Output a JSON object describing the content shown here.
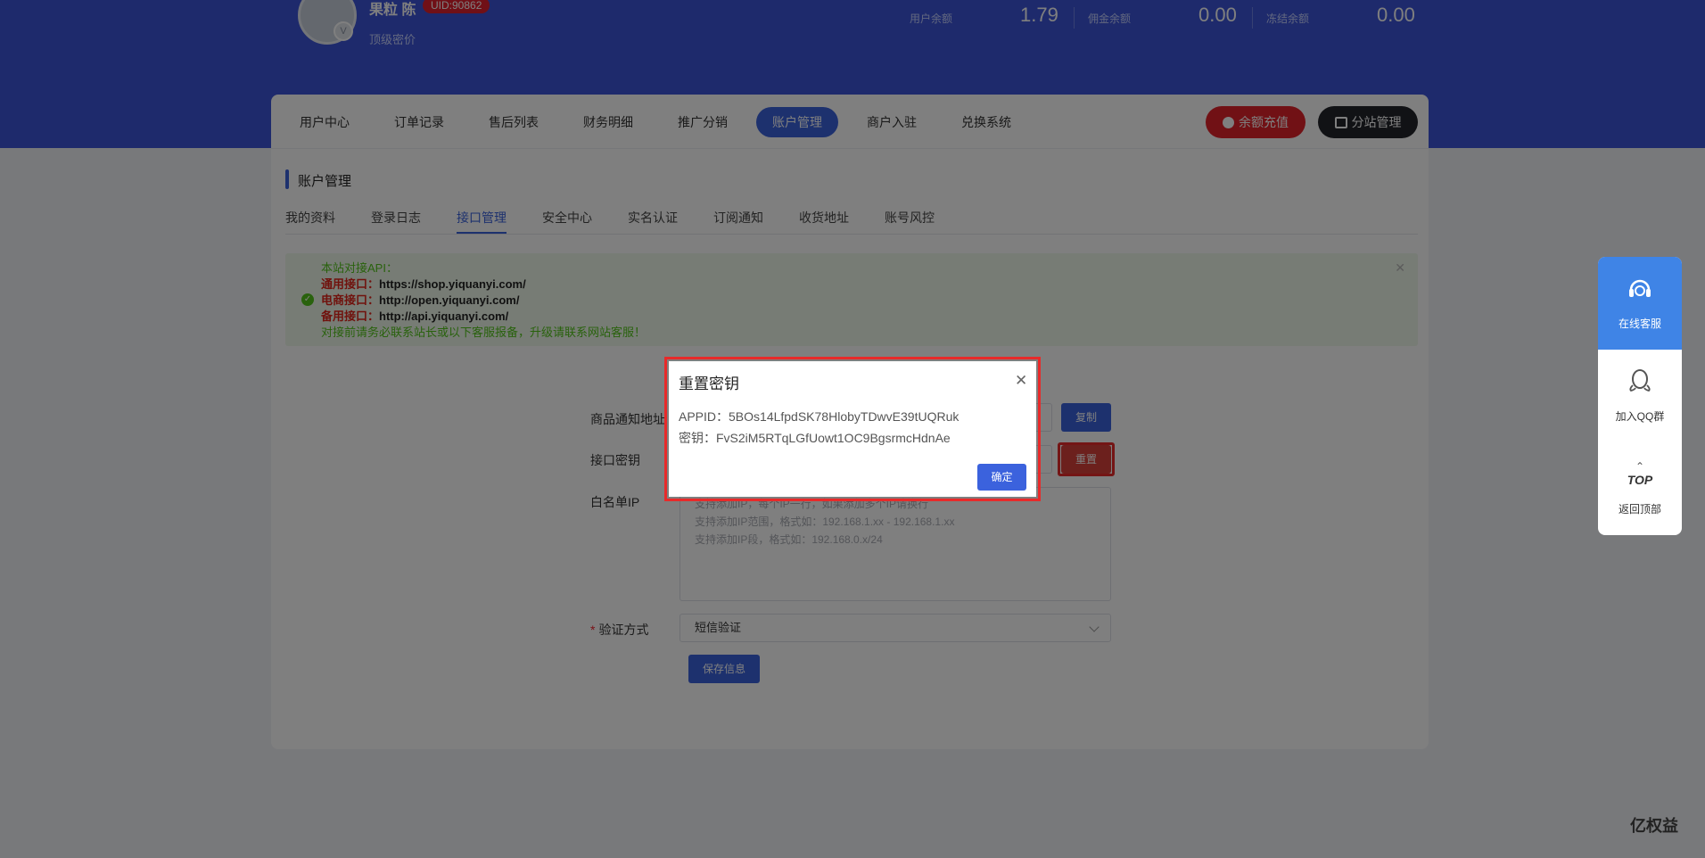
{
  "header": {
    "user_name": "果粒 陈",
    "uid": "UID:90862",
    "level": "顶级密价",
    "balances": [
      {
        "label": "用户余额",
        "value": "1.79"
      },
      {
        "label": "佣金余额",
        "value": "0.00"
      },
      {
        "label": "冻结余额",
        "value": "0.00"
      }
    ]
  },
  "nav": {
    "items": [
      "用户中心",
      "订单记录",
      "售后列表",
      "财务明细",
      "推广分销",
      "账户管理",
      "商户入驻",
      "兑换系统"
    ],
    "active": "账户管理",
    "recharge_label": "余额充值",
    "substation_label": "分站管理"
  },
  "page": {
    "section_title": "账户管理",
    "subtabs": [
      "我的资料",
      "登录日志",
      "接口管理",
      "安全中心",
      "实名认证",
      "订阅通知",
      "收货地址",
      "账号风控"
    ],
    "active_subtab": "接口管理"
  },
  "alert": {
    "intro": "本站对接API：",
    "lines": [
      {
        "label": "通用接口：",
        "url": "https://shop.yiquanyi.com/"
      },
      {
        "label": "电商接口：",
        "url": "http://open.yiquanyi.com/"
      },
      {
        "label": "备用接口：",
        "url": "http://api.yiquanyi.com/"
      }
    ],
    "note": "对接前请务必联系站长或以下客服报备，升级请联系网站客服！"
  },
  "form": {
    "notify_label": "商品通知地址",
    "copy_label": "复制",
    "key_label": "接口密钥",
    "reset_label": "重置",
    "whitelist_label": "白名单IP",
    "whitelist_placeholder": [
      "支持添加IP，每个IP一行，如果添加多个IP请换行",
      "支持添加IP范围，格式如：192.168.1.xx - 192.168.1.xx",
      "支持添加IP段，格式如：192.168.0.x/24"
    ],
    "verify_label": "验证方式",
    "verify_value": "短信验证",
    "save_label": "保存信息"
  },
  "modal": {
    "title": "重置密钥",
    "appid_line": "APPID：5BOs14LfpdSK78HlobyTDwvE39tUQRuk",
    "secret_line": "密钥：FvS2iM5RTqLGfUowt1OC9BgsrmcHdnAe",
    "ok_label": "确定"
  },
  "float": {
    "service_label": "在线客服",
    "qq_label": "加入QQ群",
    "top_text": "TOP",
    "top_label": "返回顶部"
  },
  "watermark": "亿权益",
  "colors": {
    "brand": "#3c55d9",
    "primary": "#3b62dd",
    "danger": "#e3222a",
    "success": "#52c41a"
  }
}
